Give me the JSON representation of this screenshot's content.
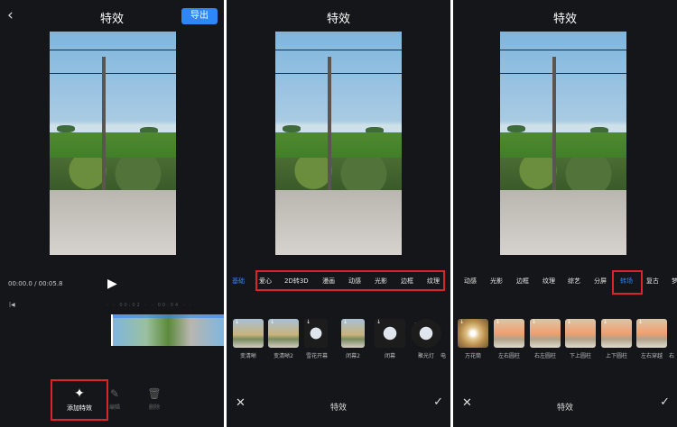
{
  "panel1": {
    "title": "特效",
    "export_label": "导出",
    "timecode": "00:00.0 / 00:05.8",
    "ruler": "· · 00:02 · · 00:04 · ·",
    "tools": [
      {
        "label": "添加特效",
        "icon": "sparkle-wand-icon"
      },
      {
        "label": "编辑",
        "icon": "edit-icon"
      },
      {
        "label": "删除",
        "icon": "trash-icon"
      }
    ]
  },
  "panel2": {
    "title": "特效",
    "categories": [
      "基础",
      "爱心",
      "2D转3D",
      "漫画",
      "动感",
      "光影",
      "边框",
      "纹理"
    ],
    "active_category": "基础",
    "effects": [
      "变清晰",
      "变清晰2",
      "雪花开幕",
      "闭幕2",
      "闭幕",
      "聚光灯",
      "电"
    ],
    "footer_title": "特效"
  },
  "panel3": {
    "title": "特效",
    "categories": [
      "动感",
      "光影",
      "边框",
      "纹理",
      "综艺",
      "分屏",
      "转场",
      "复古",
      "梦"
    ],
    "active_category": "转场",
    "effects": [
      "万花筒",
      "左右圆柱",
      "右左圆柱",
      "下上圆柱",
      "上下圆柱",
      "左右穿越",
      "右"
    ],
    "footer_title": "特效"
  },
  "colors": {
    "accent": "#2f86f6",
    "highlight_box": "#d9252a",
    "panel_bg": "#151619"
  }
}
